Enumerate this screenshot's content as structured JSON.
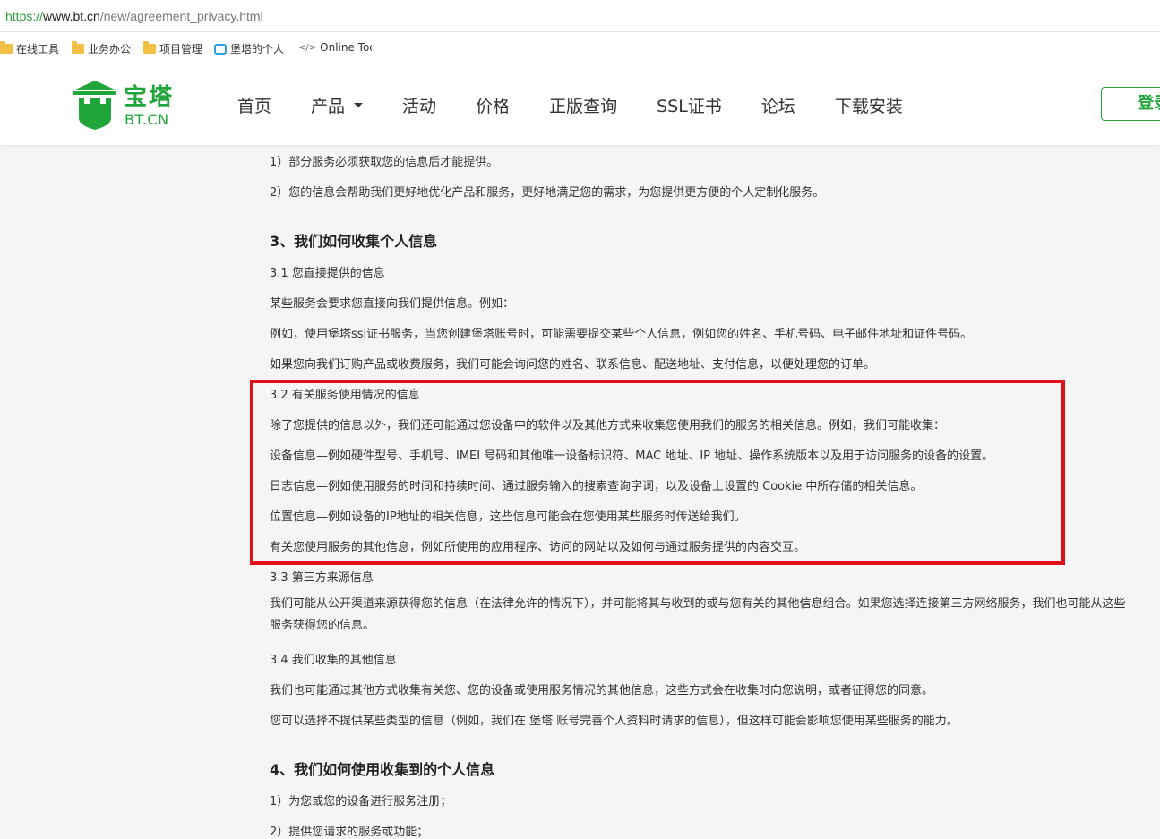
{
  "browser": {
    "url_scheme": "https://",
    "url_host": "www.bt.cn",
    "url_path": "/new/agreement_privacy.html",
    "bookmarks": [
      {
        "label": "在线工具",
        "icon": "folder-icon"
      },
      {
        "label": "业务办公",
        "icon": "folder-icon"
      },
      {
        "label": "项目管理",
        "icon": "folder-icon"
      },
      {
        "label": "堡塔的个人",
        "icon": "bilibili-icon"
      },
      {
        "label": "Online Tool",
        "icon": "code-icon"
      }
    ]
  },
  "header": {
    "logo_cn": "宝塔",
    "logo_en": "BT.CN",
    "nav": [
      "首页",
      "产品",
      "活动",
      "价格",
      "正版查询",
      "SSL证书",
      "论坛",
      "下载安装"
    ],
    "login_label": "登录",
    "brand_color": "#20a53a"
  },
  "content": {
    "intro": [
      "1）部分服务必须获取您的信息后才能提供。",
      "2）您的信息会帮助我们更好地优化产品和服务，更好地满足您的需求，为您提供更方便的个人定制化服务。"
    ],
    "section3_title": "3、我们如何收集个人信息",
    "s31_title": "3.1 您直接提供的信息",
    "s31_lines": [
      "某些服务会要求您直接向我们提供信息。例如：",
      "例如，使用堡塔ssl证书服务，当您创建堡塔账号时，可能需要提交某些个人信息，例如您的姓名、手机号码、电子邮件地址和证件号码。",
      "如果您向我们订购产品或收费服务，我们可能会询问您的姓名、联系信息、配送地址、支付信息，以便处理您的订单。"
    ],
    "s32_title": "3.2 有关服务使用情况的信息",
    "s32_lines": [
      "除了您提供的信息以外，我们还可能通过您设备中的软件以及其他方式来收集您使用我们的服务的相关信息。例如，我们可能收集：",
      "设备信息—例如硬件型号、手机号、IMEI 号码和其他唯一设备标识符、MAC 地址、IP 地址、操作系统版本以及用于访问服务的设备的设置。",
      "日志信息—例如使用服务的时间和持续时间、通过服务输入的搜索查询字词，以及设备上设置的 Cookie 中所存储的相关信息。",
      "位置信息—例如设备的IP地址的相关信息，这些信息可能会在您使用某些服务时传送给我们。",
      "有关您使用服务的其他信息，例如所使用的应用程序、访问的网站以及如何与通过服务提供的内容交互。"
    ],
    "s33_title": "3.3 第三方来源信息",
    "s33_text": "我们可能从公开渠道来源获得您的信息（在法律允许的情况下），并可能将其与收到的或与您有关的其他信息组合。如果您选择连接第三方网络服务，我们也可能从这些服务获得您的信息。",
    "s34_title": "3.4 我们收集的其他信息",
    "s34_lines": [
      "我们也可能通过其他方式收集有关您、您的设备或使用服务情况的其他信息，这些方式会在收集时向您说明，或者征得您的同意。",
      "您可以选择不提供某些类型的信息（例如，我们在 堡塔 账号完善个人资料时请求的信息），但这样可能会影响您使用某些服务的能力。"
    ],
    "section4_title": "4、我们如何使用收集到的个人信息",
    "s4_lines": [
      "1）为您或您的设备进行服务注册；",
      "2）提供您请求的服务或功能；"
    ]
  },
  "annotation": {
    "highlight_color": "#e0101a"
  }
}
